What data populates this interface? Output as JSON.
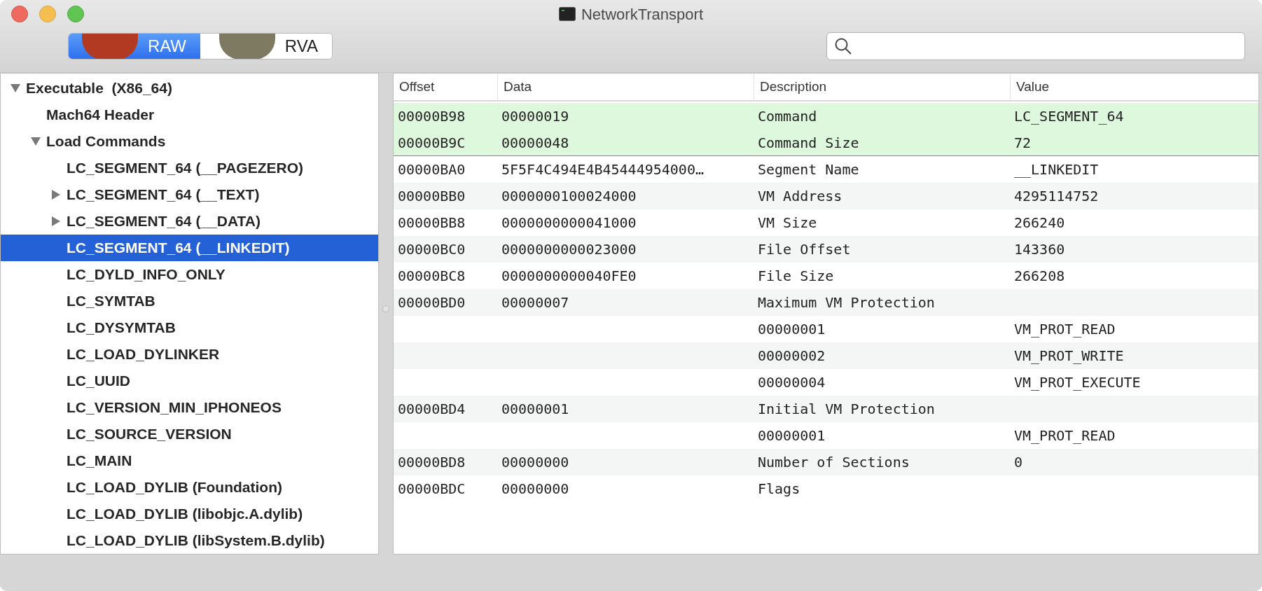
{
  "window": {
    "title": "NetworkTransport"
  },
  "mode_switch": [
    {
      "label": "RAW",
      "selected": true
    },
    {
      "label": "RVA",
      "selected": false
    }
  ],
  "tree": [
    {
      "label": "Executable  (X86_64)",
      "expanded": true,
      "selected": false,
      "children": [
        {
          "label": "Mach64 Header",
          "selected": false
        },
        {
          "label": "Load Commands",
          "expanded": true,
          "selected": false,
          "children": [
            {
              "label": "LC_SEGMENT_64 (__PAGEZERO)",
              "selected": false
            },
            {
              "label": "LC_SEGMENT_64 (__TEXT)",
              "expanded": false,
              "selected": false
            },
            {
              "label": "LC_SEGMENT_64 (__DATA)",
              "expanded": false,
              "selected": false
            },
            {
              "label": "LC_SEGMENT_64 (__LINKEDIT)",
              "selected": true
            },
            {
              "label": "LC_DYLD_INFO_ONLY",
              "selected": false
            },
            {
              "label": "LC_SYMTAB",
              "selected": false
            },
            {
              "label": "LC_DYSYMTAB",
              "selected": false
            },
            {
              "label": "LC_LOAD_DYLINKER",
              "selected": false
            },
            {
              "label": "LC_UUID",
              "selected": false
            },
            {
              "label": "LC_VERSION_MIN_IPHONEOS",
              "selected": false
            },
            {
              "label": "LC_SOURCE_VERSION",
              "selected": false
            },
            {
              "label": "LC_MAIN",
              "selected": false
            },
            {
              "label": "LC_LOAD_DYLIB (Foundation)",
              "selected": false
            },
            {
              "label": "LC_LOAD_DYLIB (libobjc.A.dylib)",
              "selected": false
            },
            {
              "label": "LC_LOAD_DYLIB (libSystem.B.dylib)",
              "selected": false
            }
          ]
        }
      ]
    }
  ],
  "table": {
    "columns": [
      "Offset",
      "Data",
      "Description",
      "Value"
    ],
    "rows": [
      {
        "offset": "00000B98",
        "data": "00000019",
        "description": "Command",
        "value": "LC_SEGMENT_64",
        "highlighted": true
      },
      {
        "offset": "00000B9C",
        "data": "00000048",
        "description": "Command Size",
        "value": "72",
        "highlighted": true
      },
      {
        "offset": "00000BA0",
        "data": "5F5F4C494E4B45444954000…",
        "description": "Segment Name",
        "value": "__LINKEDIT",
        "highlighted": false
      },
      {
        "offset": "00000BB0",
        "data": "0000000100024000",
        "description": "VM Address",
        "value": "4295114752",
        "highlighted": false
      },
      {
        "offset": "00000BB8",
        "data": "0000000000041000",
        "description": "VM Size",
        "value": "266240",
        "highlighted": false
      },
      {
        "offset": "00000BC0",
        "data": "0000000000023000",
        "description": "File Offset",
        "value": "143360",
        "highlighted": false
      },
      {
        "offset": "00000BC8",
        "data": "0000000000040FE0",
        "description": "File Size",
        "value": "266208",
        "highlighted": false
      },
      {
        "offset": "00000BD0",
        "data": "00000007",
        "description": "Maximum VM Protection",
        "highlighted": false
      },
      {
        "description": "00000001",
        "value": "VM_PROT_READ",
        "highlighted": false
      },
      {
        "description": "00000002",
        "value": "VM_PROT_WRITE",
        "highlighted": false
      },
      {
        "description": "00000004",
        "value": "VM_PROT_EXECUTE",
        "highlighted": false
      },
      {
        "offset": "00000BD4",
        "data": "00000001",
        "description": "Initial VM Protection",
        "highlighted": false
      },
      {
        "description": "00000001",
        "value": "VM_PROT_READ",
        "highlighted": false
      },
      {
        "offset": "00000BD8",
        "data": "00000000",
        "description": "Number of Sections",
        "value": "0",
        "highlighted": false
      },
      {
        "offset": "00000BDC",
        "data": "00000000",
        "description": "Flags",
        "highlighted": false
      }
    ]
  }
}
